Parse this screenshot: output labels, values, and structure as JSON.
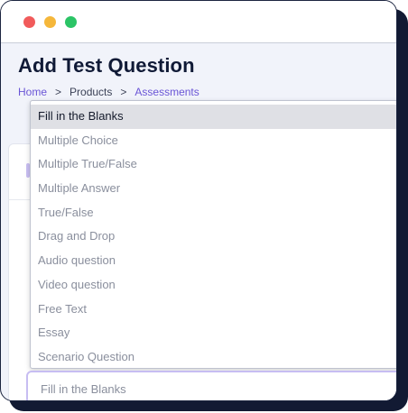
{
  "window": {
    "controls": [
      "close",
      "minimize",
      "maximize"
    ]
  },
  "page": {
    "title": "Add Test Question"
  },
  "breadcrumb": {
    "items": [
      "Home",
      "Products",
      "Assessments"
    ],
    "separator": ">"
  },
  "question_type": {
    "selected_value": "Fill in the Blanks",
    "options": [
      "Fill in the Blanks",
      "Multiple Choice",
      "Multiple True/False",
      "Multiple Answer",
      "True/False",
      "Drag and Drop",
      "Audio question",
      "Video question",
      "Free Text",
      "Essay",
      "Scenario Question"
    ]
  },
  "colors": {
    "accent": "#6a55d6",
    "title": "#101a36",
    "option_text": "#8a8f9d",
    "highlight": "#dfe0e5"
  }
}
